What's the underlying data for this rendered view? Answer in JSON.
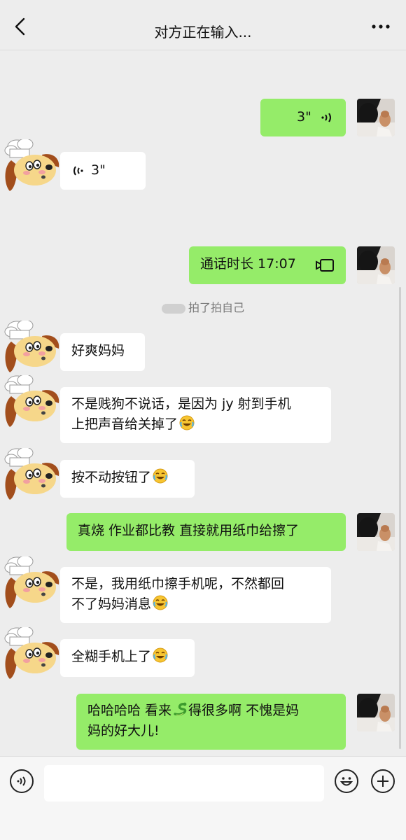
{
  "header": {
    "title": "对方正在输入..."
  },
  "system_message": "拍了拍自己",
  "messages": [
    {
      "side": "right",
      "type": "voice",
      "duration": "3\""
    },
    {
      "side": "left",
      "type": "voice",
      "duration": "3\""
    },
    {
      "side": "right",
      "type": "call",
      "text": "通话时长 17:07"
    },
    {
      "side": "left",
      "type": "text",
      "text": "好爽妈妈"
    },
    {
      "side": "left",
      "type": "text",
      "line1": "不是贱狗不说话，是因为 jy 射到手机",
      "line2": "上把声音给关掉了"
    },
    {
      "side": "left",
      "type": "text",
      "text": "按不动按钮了"
    },
    {
      "side": "right",
      "type": "text",
      "text": "真烧 作业都比教 直接就用纸巾给擦了"
    },
    {
      "side": "left",
      "type": "text",
      "line1": "不是，我用纸巾擦手机呢，不然都回",
      "line2": "不了妈妈消息"
    },
    {
      "side": "left",
      "type": "text",
      "text": "全糊手机上了"
    },
    {
      "side": "right",
      "type": "text",
      "line1a": "哈哈哈哈 看来",
      "line1b": "得很多啊 不愧是妈",
      "line2": "妈的好大儿!"
    }
  ],
  "colors": {
    "bg": "#ededed",
    "right_bubble": "#95ec69",
    "left_bubble": "#ffffff"
  },
  "icons": [
    "back-arrow-icon",
    "more-icon",
    "voice-wave-icon",
    "video-call-icon",
    "laughing-emoji-icon",
    "snake-emoji-icon",
    "voice-input-icon",
    "smile-icon",
    "plus-icon"
  ]
}
